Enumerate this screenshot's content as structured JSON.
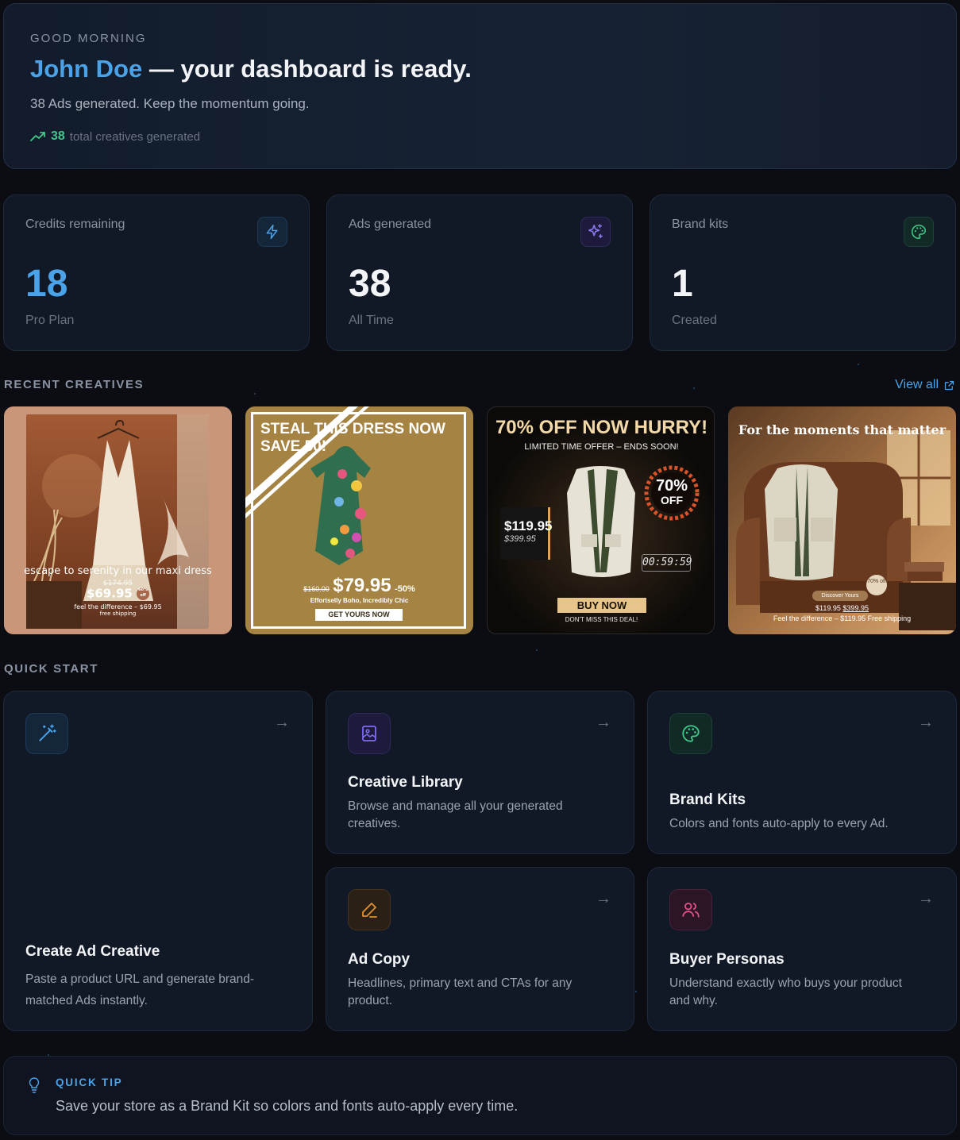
{
  "hero": {
    "greeting": "GOOD MORNING",
    "name": "John Doe",
    "headline_rest": " — your dashboard is ready.",
    "subtitle": "38 Ads generated. Keep the momentum going.",
    "trend_value": "38",
    "trend_label": "total creatives generated"
  },
  "stats": [
    {
      "label": "Credits remaining",
      "value": "18",
      "footer": "Pro Plan",
      "icon": "lightning-icon",
      "color": "#4aa3e8"
    },
    {
      "label": "Ads generated",
      "value": "38",
      "footer": "All Time",
      "icon": "sparkles-icon",
      "color": "#f2f4f8"
    },
    {
      "label": "Brand kits",
      "value": "1",
      "footer": "Created",
      "icon": "palette-icon",
      "color": "#f2f4f8"
    }
  ],
  "recent": {
    "title": "RECENT CREATIVES",
    "view_all": "View all",
    "creatives": [
      {
        "caption": "escape to serenity in our maxi dress",
        "old_price": "$174.95",
        "price": "$69.95",
        "badge": "60% off",
        "foot": "feel the difference – $69.95",
        "foot2": "free shipping"
      },
      {
        "headline": "STEAL THIS DRESS NOW",
        "headline2": "SAVE 50!",
        "old_price": "$160.00",
        "price": "$79.95",
        "discount": "-50%",
        "tagline": "Effortselly Boho, Incredibly Chic",
        "cta": "GET YOURS NOW"
      },
      {
        "headline": "70% OFF NOW HURRY!",
        "sub": "LIMITED TIME OFFER – ENDS SOON!",
        "price": "$119.95",
        "old_price": "$399.95",
        "badge_top": "70%",
        "badge_bottom": "OFF",
        "timer": "00:59:59",
        "cta": "BUY NOW",
        "foot": "DON'T MISS THIS DEAL!"
      },
      {
        "headline": "For the moments that matter",
        "badge": "70% off",
        "pill": "Discover Yours",
        "price": "$119.95",
        "old_price": "$399.95",
        "foot": "Feel the difference – $119.95 Free shipping"
      }
    ]
  },
  "quick_start": {
    "title": "QUICK START",
    "items": [
      {
        "title": "Create Ad Creative",
        "desc": "Paste a product URL and generate brand-matched Ads instantly.",
        "icon": "magic-wand-icon"
      },
      {
        "title": "Creative Library",
        "desc": "Browse and manage all your generated creatives.",
        "icon": "image-icon"
      },
      {
        "title": "Brand Kits",
        "desc": "Colors and fonts auto-apply to every Ad.",
        "icon": "palette-icon"
      },
      {
        "title": "Ad Copy",
        "desc": "Headlines, primary text and CTAs for any product.",
        "icon": "pencil-icon"
      },
      {
        "title": "Buyer Personas",
        "desc": "Understand exactly who buys your product and why.",
        "icon": "users-icon"
      }
    ]
  },
  "tip": {
    "title": "QUICK TIP",
    "text": "Save your store as a Brand Kit so colors and fonts auto-apply every time."
  }
}
